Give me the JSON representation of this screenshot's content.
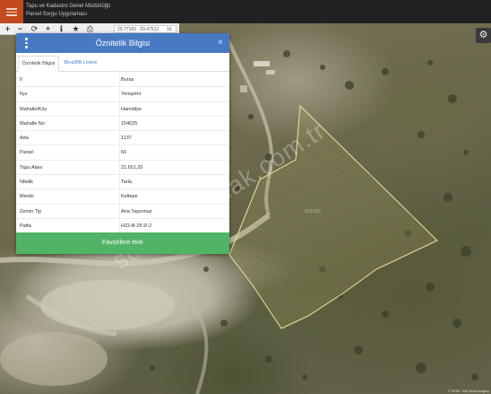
{
  "app": {
    "title_line1": "Tapu ve Kadastro Genel Müdürlüğü",
    "title_line2": "Parsel Sorgu Uygulaması"
  },
  "toolbar": {
    "coordinates": "20.77183 · 29.47512",
    "zoom": "16"
  },
  "panel": {
    "title": "Öznitelik Bilgisi",
    "close": "×",
    "tabs": [
      {
        "label": "Öznitelik Bilgisi"
      },
      {
        "label": "Bina/BB Listesi"
      }
    ],
    "rows": [
      {
        "label": "İl",
        "value": "Bursa"
      },
      {
        "label": "İlçe",
        "value": "Yenişehir"
      },
      {
        "label": "Mahalle/Köy",
        "value": "Hamidiye"
      },
      {
        "label": "Mahalle No",
        "value": "154025"
      },
      {
        "label": "Ada",
        "value": "1137"
      },
      {
        "label": "Parsel",
        "value": "60"
      },
      {
        "label": "Tapu Alanı",
        "value": "21.651,20"
      },
      {
        "label": "Nitelik",
        "value": "Tarla"
      },
      {
        "label": "Mevkii",
        "value": "Keltepe"
      },
      {
        "label": "Zemin Tip",
        "value": "Ana Taşınmaz"
      },
      {
        "label": "Pafta",
        "value": "H22-B-25-D-2"
      }
    ],
    "favorite_button": "Favorilere ekle"
  },
  "map": {
    "watermark": "sonmezemlak.com.tr",
    "parcel_label": "1137/60",
    "attribution": "© TKGM · Esri World Imagery"
  },
  "colors": {
    "header_bg": "#212124",
    "menu_accent": "#c24a1e",
    "panel_header": "#4679c2",
    "favorite_button": "#50b366",
    "parcel_outline": "#f0e59a"
  },
  "icons": [
    "hamburger-menu-icon",
    "zoom-in-icon",
    "zoom-out-icon",
    "refresh-icon",
    "locate-icon",
    "info-icon",
    "star-icon",
    "print-icon",
    "gear-icon",
    "kebab-menu-icon",
    "close-icon"
  ]
}
